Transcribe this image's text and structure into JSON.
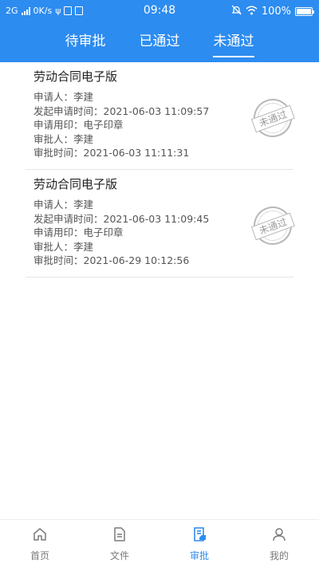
{
  "status_bar": {
    "network": "2G",
    "speed": "0K/s",
    "time": "09:48",
    "battery": "100%"
  },
  "tabs": [
    {
      "label": "待审批"
    },
    {
      "label": "已通过"
    },
    {
      "label": "未通过"
    }
  ],
  "active_tab": "未通过",
  "records": [
    {
      "title": "劳动合同电子版",
      "applicant_label": "申请人：",
      "applicant": "李建",
      "apply_time_label": "发起申请时间：",
      "apply_time": "2021-06-03 11:09:57",
      "seal_label": "申请用印：",
      "seal": "电子印章",
      "approver_label": "审批人：",
      "approver": "李建",
      "approve_time_label": "审批时间：",
      "approve_time": "2021-06-03 11:11:31",
      "stamp": "未通过"
    },
    {
      "title": "劳动合同电子版",
      "applicant_label": "申请人：",
      "applicant": "李建",
      "apply_time_label": "发起申请时间：",
      "apply_time": "2021-06-03 11:09:45",
      "seal_label": "申请用印：",
      "seal": "电子印章",
      "approver_label": "审批人：",
      "approver": "李建",
      "approve_time_label": "审批时间：",
      "approve_time": "2021-06-29 10:12:56",
      "stamp": "未通过"
    }
  ],
  "bottom_nav": [
    {
      "label": "首页",
      "icon": "home-icon"
    },
    {
      "label": "文件",
      "icon": "file-icon"
    },
    {
      "label": "审批",
      "icon": "approval-icon"
    },
    {
      "label": "我的",
      "icon": "user-icon"
    }
  ],
  "colors": {
    "primary": "#2d8cf0",
    "text": "#333333",
    "muted": "#7a7a7a"
  }
}
